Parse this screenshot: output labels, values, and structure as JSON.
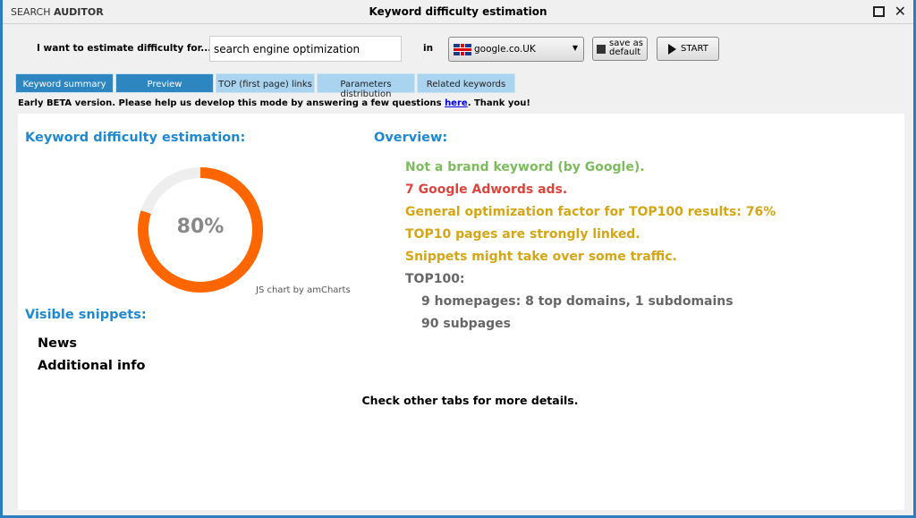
{
  "window": {
    "logo": "SEARCH AUDITOR",
    "logo_a": "SEARCH ",
    "logo_b": "AUDITOR",
    "title": "Keyword difficulty estimation"
  },
  "toolbar": {
    "prompt": "I want to estimate difficulty for...",
    "keyword": "search engine optimization",
    "in_label": "in",
    "engine": "google.co.UK",
    "save_label_1": "save as",
    "save_label_2": "default",
    "start_label": "START"
  },
  "tabs": [
    {
      "label": "Keyword summary",
      "active": true
    },
    {
      "label": "Preview",
      "active": true
    },
    {
      "label": "TOP (first page) links"
    },
    {
      "label": "Parameters distribution"
    },
    {
      "label": "Related keywords"
    }
  ],
  "beta": {
    "text": "Early BETA version. Please help us develop this mode by answering a few questions ",
    "link": "here",
    "end": ". Thank you!"
  },
  "difficulty": {
    "heading": "Keyword difficulty estimation:",
    "value_label": "80%",
    "value": 80,
    "credit": "JS chart by amCharts",
    "color": "#ff6600"
  },
  "overview": {
    "heading": "Overview:",
    "lines": [
      {
        "text": "Not a brand keyword (by Google).",
        "color": "#7cbc5c"
      },
      {
        "text": "7 Google Adwords ads.",
        "color": "#d9453c"
      },
      {
        "text": "General optimization factor for TOP100 results: 76%",
        "color": "#d4a514"
      },
      {
        "text": "TOP10 pages are strongly linked.",
        "color": "#d4a514"
      },
      {
        "text": "Snippets might take over some traffic.",
        "color": "#d4a514"
      },
      {
        "text": "TOP100:",
        "color": "#666666"
      },
      {
        "text": "9 homepages: 8 top domains, 1 subdomains",
        "color": "#666666",
        "indent": true
      },
      {
        "text": "90 subpages",
        "color": "#666666",
        "indent": true
      }
    ]
  },
  "snippets": {
    "heading": "Visible snippets:",
    "items": [
      "News",
      "Additional info"
    ]
  },
  "footer": "Check other tabs for more details."
}
